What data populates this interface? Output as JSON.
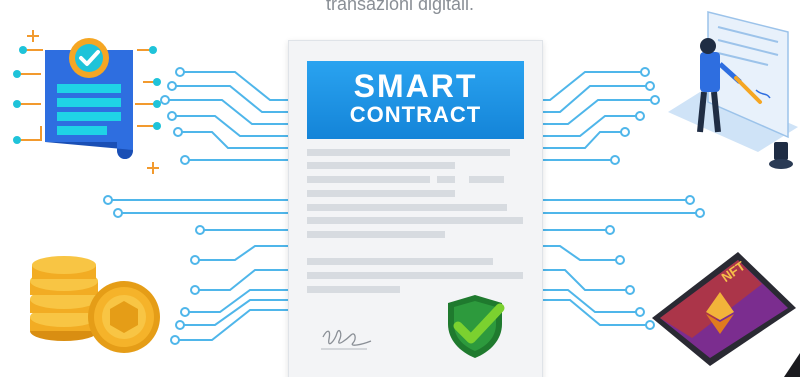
{
  "caption": "transazioni digitali.",
  "banner": {
    "line1": "SMART",
    "line2": "CONTRACT"
  },
  "badge_text": "NFT",
  "colors": {
    "circuit": "#4fb6ea",
    "banner": "#1d8fe3",
    "shield": "#1f7a2e",
    "check": "#7bd12f",
    "coin": "#f5b32a",
    "phone": "#7b2d8f",
    "scroll": "#2e6ee0"
  },
  "icons": [
    "scroll-checklist-icon",
    "developer-laptop-icon",
    "coins-stack-icon",
    "nft-phone-icon",
    "shield-check-icon",
    "signature-icon"
  ]
}
